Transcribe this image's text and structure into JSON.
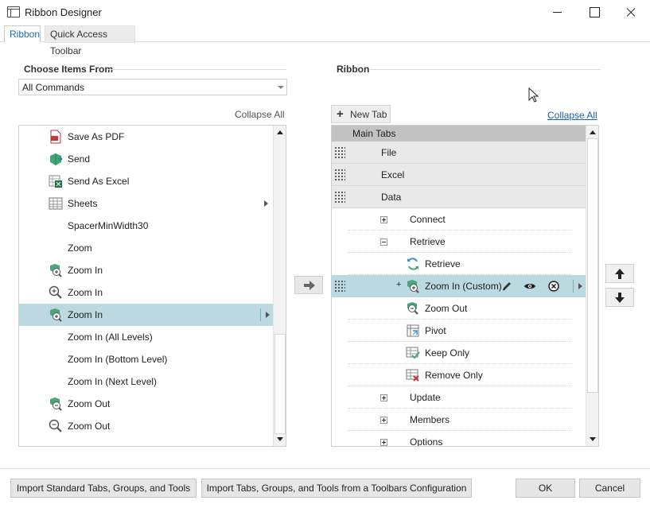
{
  "window": {
    "title": "Ribbon Designer"
  },
  "tabs": [
    {
      "label": "Ribbon"
    },
    {
      "label": "Quick Access Toolbar"
    }
  ],
  "left_panel": {
    "title": "Choose Items From",
    "source_value": "All Commands",
    "collapse_label": "Collapse All",
    "items": [
      {
        "label": "Save As PDF",
        "icon": "pdf-icon"
      },
      {
        "label": "Send",
        "icon": "send-icon"
      },
      {
        "label": "Send As Excel",
        "icon": "excel-icon"
      },
      {
        "label": "Sheets",
        "icon": "sheets-icon",
        "submenu": true
      },
      {
        "label": "SpacerMinWidth30",
        "icon": ""
      },
      {
        "label": "Zoom",
        "icon": ""
      },
      {
        "label": "Zoom In",
        "icon": "zoom-in-green-icon"
      },
      {
        "label": "Zoom In",
        "icon": "magnifier-plus-icon"
      },
      {
        "label": "Zoom In",
        "icon": "zoom-in-green-icon",
        "selected": true,
        "submenu": true
      },
      {
        "label": "Zoom In (All Levels)",
        "icon": ""
      },
      {
        "label": "Zoom In (Bottom Level)",
        "icon": ""
      },
      {
        "label": "Zoom In (Next Level)",
        "icon": ""
      },
      {
        "label": "Zoom Out",
        "icon": "zoom-out-green-icon"
      },
      {
        "label": "Zoom Out",
        "icon": "magnifier-minus-icon"
      }
    ]
  },
  "right_panel": {
    "title": "Ribbon",
    "new_tab_label": "New Tab",
    "new_tab_icon": "+",
    "collapse_label": "Collapse All",
    "header_label": "Main Tabs",
    "rows": [
      {
        "label": "File",
        "kind": "tab"
      },
      {
        "label": "Excel",
        "kind": "tab"
      },
      {
        "label": "Data",
        "kind": "tab"
      },
      {
        "label": "Connect",
        "kind": "group",
        "expander": "plus"
      },
      {
        "label": "Retrieve",
        "kind": "group",
        "expander": "minus"
      },
      {
        "label": "Retrieve",
        "kind": "command",
        "icon": "refresh-icon"
      },
      {
        "label": "Zoom In (Custom)",
        "kind": "command",
        "icon": "zoom-in-green-icon",
        "selected": true,
        "expander": "+"
      },
      {
        "label": "Zoom Out",
        "kind": "command",
        "icon": "zoom-out-green-icon"
      },
      {
        "label": "Pivot",
        "kind": "command",
        "icon": "pivot-icon"
      },
      {
        "label": "Keep Only",
        "kind": "command",
        "icon": "keep-only-icon"
      },
      {
        "label": "Remove Only",
        "kind": "command",
        "icon": "remove-only-icon"
      },
      {
        "label": "Update",
        "kind": "group",
        "expander": "plus"
      },
      {
        "label": "Members",
        "kind": "group",
        "expander": "plus"
      },
      {
        "label": "Options",
        "kind": "group",
        "expander": "plus"
      }
    ]
  },
  "footer": {
    "import_standard": "Import Standard Tabs, Groups, and Tools",
    "import_config": "Import Tabs, Groups, and Tools from a Toolbars Configuration",
    "ok": "OK",
    "cancel": "Cancel"
  },
  "colors": {
    "selection": "#bcd9e1",
    "accent": "#1a6fa8",
    "link": "#1a5fb0"
  }
}
